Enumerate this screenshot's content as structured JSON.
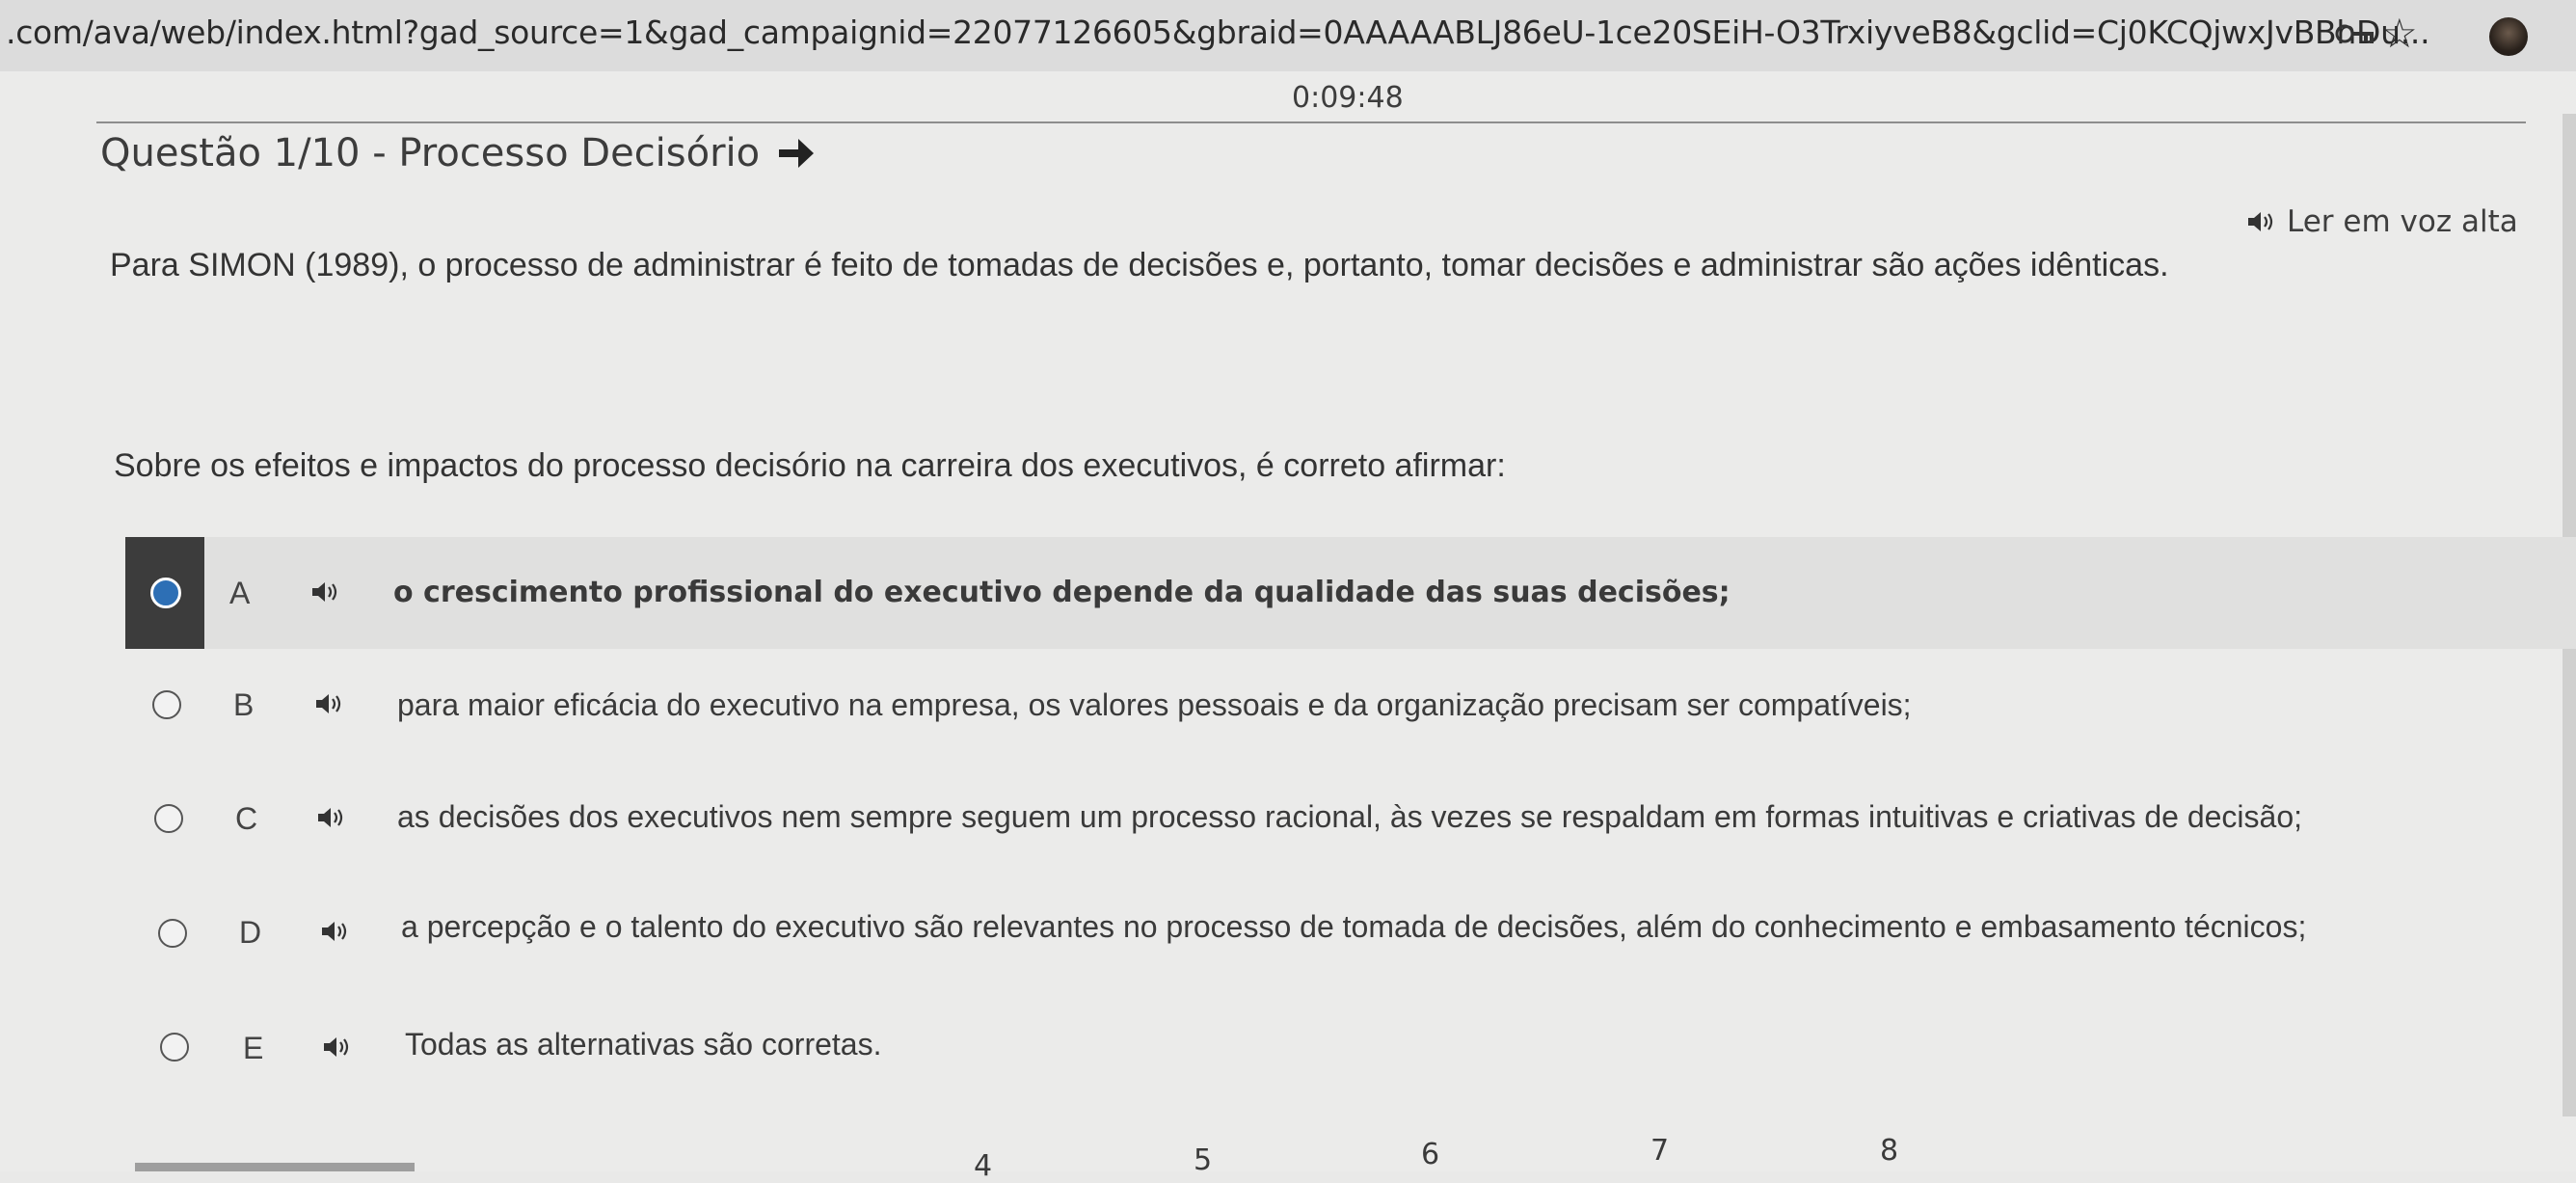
{
  "browser": {
    "url": ".com/ava/web/index.html?gad_source=1&gad_campaignid=22077126605&gbraid=0AAAAABLJ86eU-1ce20SEiH-O3TrxiyveB8&gclid=Cj0KCQjwxJvBBhDu..."
  },
  "timer": "0:09:48",
  "question": {
    "title": "Questão 1/10 - Processo Decisório",
    "read_aloud_label": "Ler em voz alta",
    "statement": "Para SIMON (1989), o processo de administrar é feito de tomadas de decisões e, portanto, tomar decisões e administrar são ações idênticas.",
    "prompt": "Sobre os efeitos e impactos do processo decisório na carreira dos executivos, é correto afirmar:"
  },
  "options": [
    {
      "letter": "A",
      "text": "o crescimento profissional do executivo depende da qualidade das suas decisões;",
      "selected": true
    },
    {
      "letter": "B",
      "text": "para maior eficácia do executivo na empresa, os valores pessoais e da organização precisam ser compatíveis;",
      "selected": false
    },
    {
      "letter": "C",
      "text": "as decisões dos executivos nem sempre seguem um processo racional, às vezes se respaldam em formas intuitivas e criativas de decisão;",
      "selected": false
    },
    {
      "letter": "D",
      "text": "a percepção e o talento do executivo são relevantes no processo de tomada de decisões, além do conhecimento e embasamento técnicos;",
      "selected": false
    },
    {
      "letter": "E",
      "text": "Todas as alternativas são corretas.",
      "selected": false
    }
  ],
  "pager": {
    "numbers": [
      "4",
      "5",
      "6",
      "7",
      "8"
    ]
  },
  "colors": {
    "selected_radio": "#2d6fb5",
    "selected_marker": "#3c3c3c"
  },
  "icons": [
    "key-icon",
    "star-icon",
    "avatar",
    "arrow-right-icon",
    "speaker-icon"
  ]
}
